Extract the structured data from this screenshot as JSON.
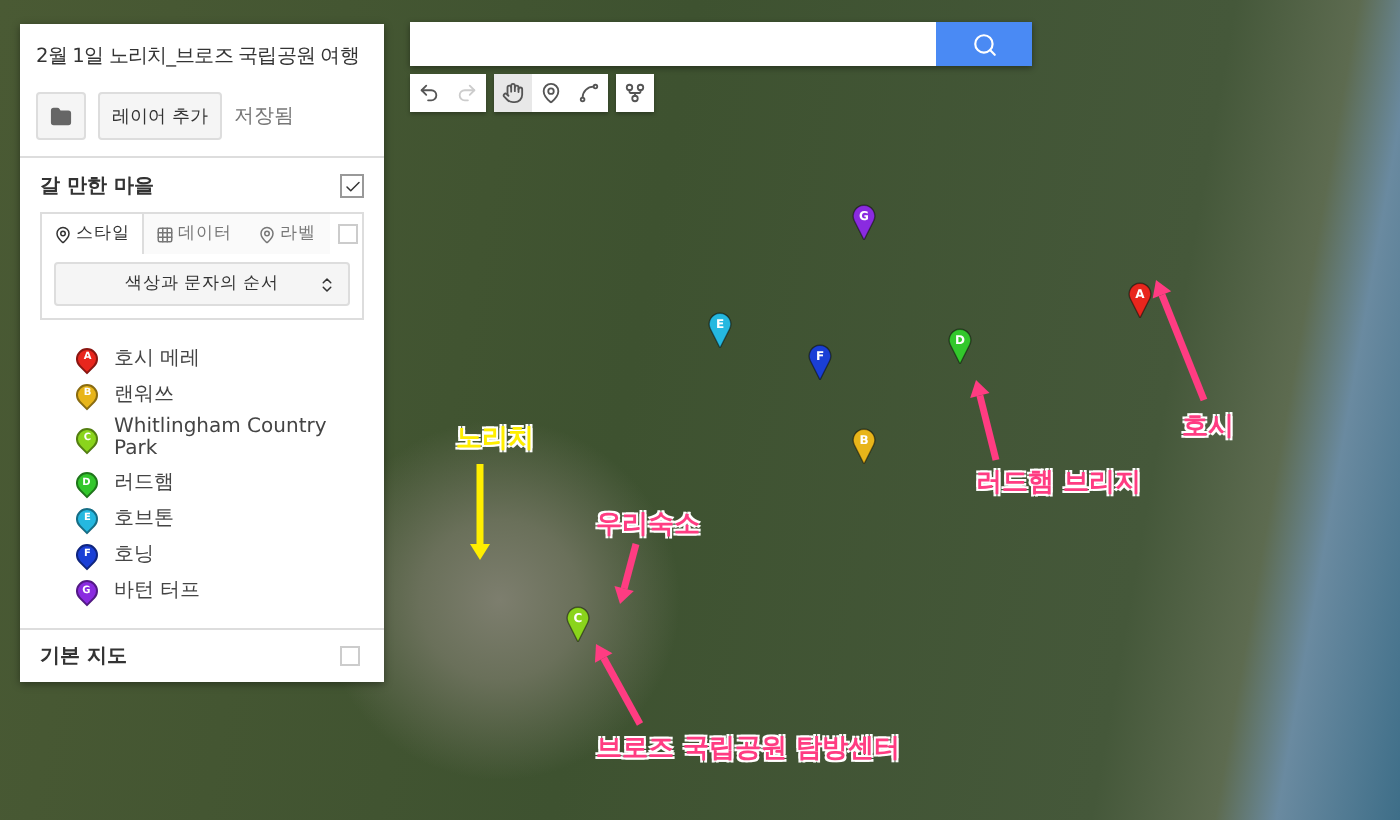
{
  "toolbar": [
    {
      "kind": "undo",
      "disabled": false,
      "selected": false
    },
    {
      "kind": "redo",
      "disabled": true,
      "selected": false
    },
    {
      "kind": "hand",
      "disabled": false,
      "selected": true
    },
    {
      "kind": "marker",
      "disabled": false,
      "selected": false
    },
    {
      "kind": "line",
      "disabled": false,
      "selected": false
    },
    {
      "kind": "route",
      "disabled": false,
      "selected": false
    }
  ],
  "panel": {
    "title": "2월 1일 노리치_브로즈 국립공원 여행",
    "add_layer": "레이어 추가",
    "save_status": "저장됨",
    "layer": {
      "name": "갈 만한 마을",
      "checked": true,
      "tabs": [
        {
          "kind": "style",
          "label": "스타일",
          "selected": true
        },
        {
          "kind": "data",
          "label": "데이터",
          "selected": false
        },
        {
          "kind": "label",
          "label": "라벨",
          "selected": false
        }
      ],
      "style_select": "색상과 문자의 순서",
      "items": [
        {
          "letter": "A",
          "name": "호시 메레",
          "color": "#e8261d"
        },
        {
          "letter": "B",
          "name": "랜워쓰",
          "color": "#e8b51a"
        },
        {
          "letter": "C",
          "name": "Whitlingham Country Park",
          "color": "#8ad41c"
        },
        {
          "letter": "D",
          "name": "러드햄",
          "color": "#33c72c"
        },
        {
          "letter": "E",
          "name": "호브톤",
          "color": "#25b8e0"
        },
        {
          "letter": "F",
          "name": "호닝",
          "color": "#1a3fd6"
        },
        {
          "letter": "G",
          "name": "바턴 터프",
          "color": "#8a2be0"
        }
      ]
    },
    "base_map": "기본 지도"
  },
  "map_pins": [
    {
      "letter": "A",
      "color": "#e8261d"
    },
    {
      "letter": "B",
      "color": "#e8b51a"
    },
    {
      "letter": "C",
      "color": "#8ad41c"
    },
    {
      "letter": "D",
      "color": "#33c72c"
    },
    {
      "letter": "E",
      "color": "#25b8e0"
    },
    {
      "letter": "F",
      "color": "#1a3fd6"
    },
    {
      "letter": "G",
      "color": "#8a2be0"
    }
  ],
  "annotations": [
    {
      "text": "노리치",
      "color": "#ffee00"
    },
    {
      "text": "우리숙소",
      "color": "#ff3c82"
    },
    {
      "text": "브로즈 국립공원 탐방센터",
      "color": "#ff3c82"
    },
    {
      "text": "러드햄 브리지",
      "color": "#ff3c82"
    },
    {
      "text": "호시",
      "color": "#ff3c82"
    }
  ]
}
